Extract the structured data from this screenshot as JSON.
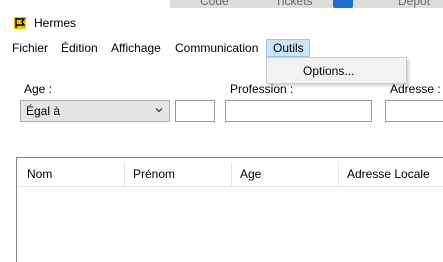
{
  "background_window": {
    "items": [
      "Code",
      "Tickets",
      "Dépôt"
    ]
  },
  "window": {
    "title": "Hermes",
    "icon": "hermes-flag-icon"
  },
  "menu": {
    "items": [
      "Fichier",
      "Édition",
      "Affichage",
      "Communication",
      "Outils"
    ],
    "active": "Outils",
    "dropdown": {
      "items": [
        "Options..."
      ]
    }
  },
  "filters": {
    "age_label": "Age :",
    "age_operator": "Égal à",
    "age_value": "",
    "profession_label": "Profession :",
    "profession_value": "",
    "address_label": "Adresse :",
    "address_value": ""
  },
  "table": {
    "columns": [
      "Nom",
      "Prénom",
      "Age",
      "Adresse Locale"
    ],
    "rows": []
  },
  "colors": {
    "menu_active_bg": "#cce4f7",
    "menu_active_border": "#99c9ef",
    "icon_yellow": "#f5c400"
  }
}
